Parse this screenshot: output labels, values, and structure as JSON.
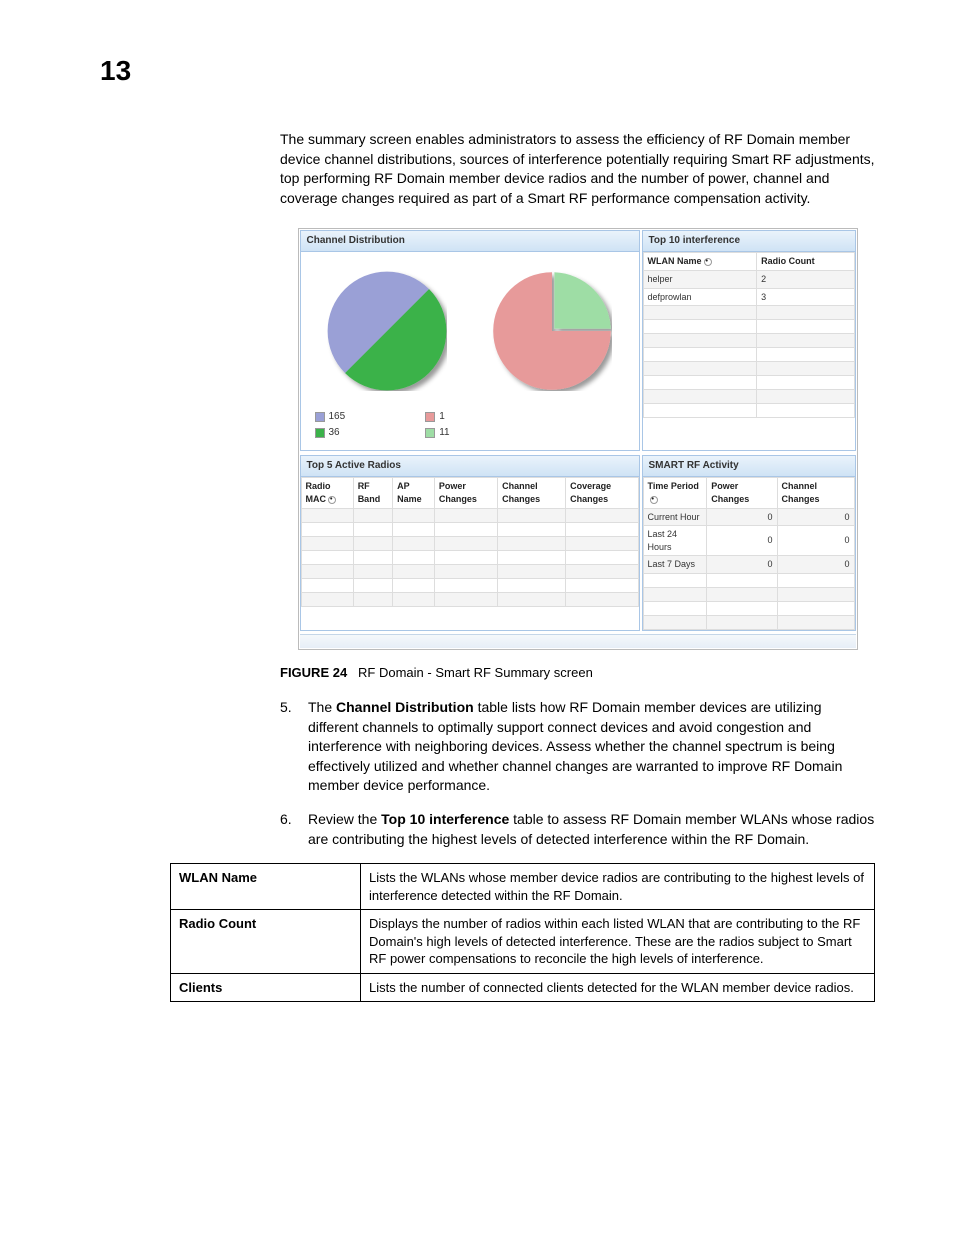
{
  "page_number": "13",
  "intro_paragraph": "The summary screen enables administrators to assess the efficiency of RF Domain member device channel distributions, sources of interference potentially requiring Smart RF adjustments, top performing RF Domain member device radios and the number of power, channel and coverage changes required as part of a Smart RF performance compensation activity.",
  "screenshot": {
    "channel_dist": {
      "title": "Channel Distribution",
      "legend_left": [
        {
          "color": "#9aa0d6",
          "label": "165"
        },
        {
          "color": "#3bb24a",
          "label": "36"
        }
      ],
      "legend_right": [
        {
          "color": "#e79a9a",
          "label": "1"
        },
        {
          "color": "#9edda5",
          "label": "11"
        }
      ]
    },
    "top10": {
      "title": "Top 10 interference",
      "columns": {
        "c1": "WLAN Name",
        "c2": "Radio Count"
      },
      "rows": [
        {
          "name": "helper",
          "count": "2"
        },
        {
          "name": "defprowlan",
          "count": "3"
        }
      ]
    },
    "top5": {
      "title": "Top 5 Active Radios",
      "columns": {
        "c1": "Radio MAC",
        "c2": "RF Band",
        "c3": "AP Name",
        "c4": "Power Changes",
        "c5": "Channel Changes",
        "c6": "Coverage Changes"
      }
    },
    "smartrf": {
      "title": "SMART RF Activity",
      "columns": {
        "c1": "Time Period",
        "c2": "Power Changes",
        "c3": "Channel Changes"
      },
      "rows": [
        {
          "period": "Current Hour",
          "power": "0",
          "channel": "0"
        },
        {
          "period": "Last 24 Hours",
          "power": "0",
          "channel": "0"
        },
        {
          "period": "Last 7 Days",
          "power": "0",
          "channel": "0"
        }
      ]
    }
  },
  "figure": {
    "label": "FIGURE 24",
    "caption": "RF Domain - Smart RF Summary screen"
  },
  "steps": [
    {
      "num": "5.",
      "prefix": "The ",
      "bold": "Channel Distribution",
      "suffix": " table lists how RF Domain member devices are utilizing different channels to optimally support connect devices and avoid congestion and interference with neighboring devices. Assess whether the channel spectrum is being effectively utilized and whether channel changes are warranted to improve RF Domain member device performance."
    },
    {
      "num": "6.",
      "prefix": "Review the ",
      "bold": "Top 10 interference",
      "suffix": " table to assess RF Domain member WLANs whose radios are contributing the highest levels of detected interference within the RF Domain."
    }
  ],
  "def_table": [
    {
      "term": "WLAN Name",
      "desc": "Lists the WLANs whose member device radios are contributing to the highest levels of interference detected within the RF Domain."
    },
    {
      "term": "Radio Count",
      "desc": "Displays the number of radios within each listed WLAN that are contributing to the RF Domain's high levels of detected interference. These are the radios subject to Smart RF power compensations to reconcile the high levels of interference."
    },
    {
      "term": "Clients",
      "desc": "Lists the number of connected clients detected for the WLAN member device radios."
    }
  ],
  "chart_data": [
    {
      "type": "pie",
      "title": "Channel Distribution (left)",
      "categories": [
        "165",
        "36"
      ],
      "values": [
        50,
        50
      ],
      "colors": [
        "#9aa0d6",
        "#3bb24a"
      ]
    },
    {
      "type": "pie",
      "title": "Channel Distribution (right)",
      "categories": [
        "1",
        "11"
      ],
      "values": [
        75,
        25
      ],
      "colors": [
        "#e79a9a",
        "#9edda5"
      ]
    }
  ]
}
